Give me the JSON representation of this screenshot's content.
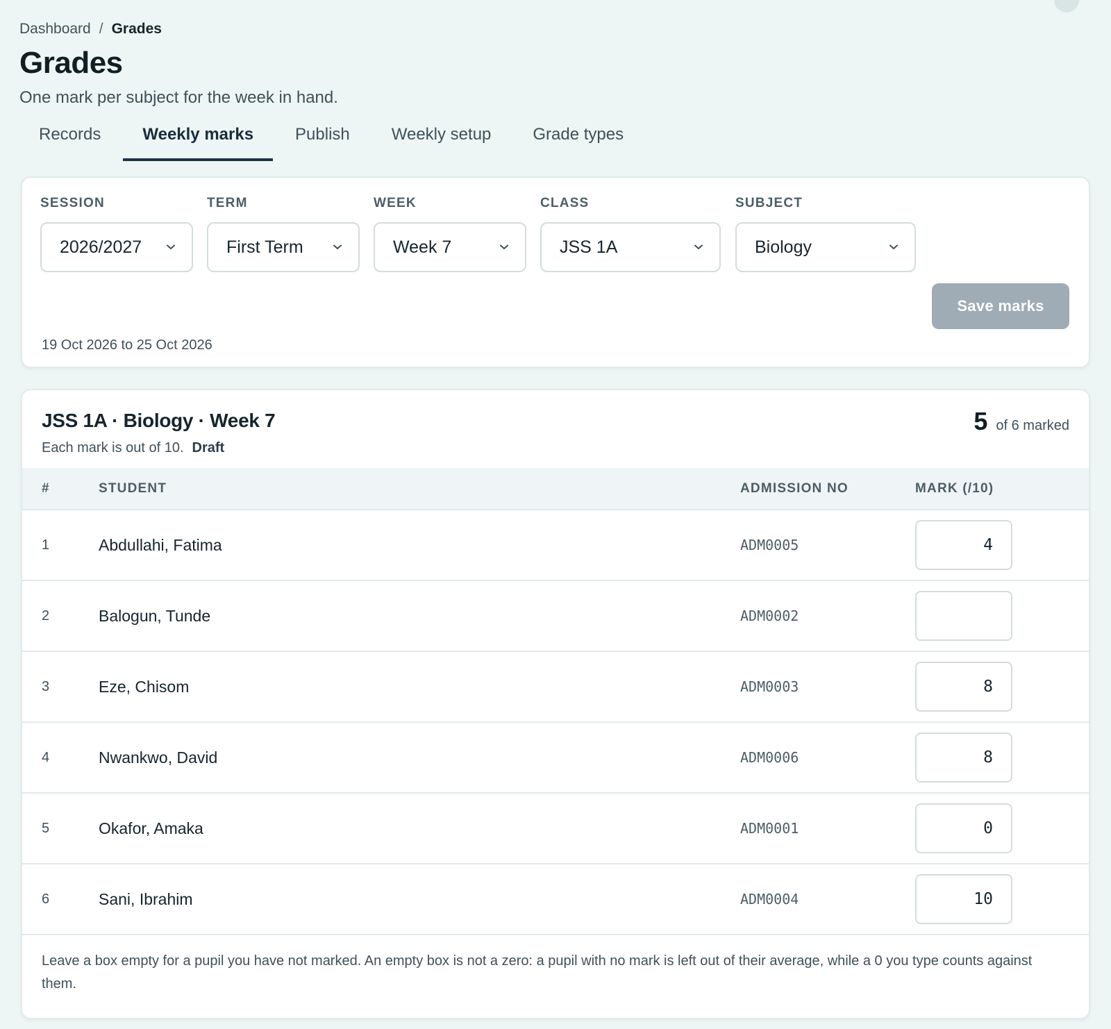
{
  "breadcrumb": {
    "parent": "Dashboard",
    "separator": "/",
    "current": "Grades"
  },
  "page": {
    "title": "Grades",
    "subtitle": "One mark per subject for the week in hand."
  },
  "tabs": [
    {
      "label": "Records",
      "active": false
    },
    {
      "label": "Weekly marks",
      "active": true
    },
    {
      "label": "Publish",
      "active": false
    },
    {
      "label": "Weekly setup",
      "active": false
    },
    {
      "label": "Grade types",
      "active": false
    }
  ],
  "filters": {
    "session": {
      "label": "SESSION",
      "value": "2026/2027"
    },
    "term": {
      "label": "TERM",
      "value": "First Term"
    },
    "week": {
      "label": "WEEK",
      "value": "Week 7"
    },
    "class": {
      "label": "CLASS",
      "value": "JSS 1A"
    },
    "subject": {
      "label": "SUBJECT",
      "value": "Biology"
    },
    "save_label": "Save marks",
    "date_range": "19 Oct 2026 to 25 Oct 2026"
  },
  "marks_table": {
    "heading": "JSS 1A · Biology · Week 7",
    "out_of_note": "Each mark is out of 10.",
    "status": "Draft",
    "marked_count": "5",
    "marked_total_text": "of 6 marked",
    "columns": {
      "num": "#",
      "student": "STUDENT",
      "admission": "ADMISSION NO",
      "mark": "MARK (/10)"
    },
    "rows": [
      {
        "num": "1",
        "student": "Abdullahi, Fatima",
        "admission": "ADM0005",
        "mark": "4"
      },
      {
        "num": "2",
        "student": "Balogun, Tunde",
        "admission": "ADM0002",
        "mark": ""
      },
      {
        "num": "3",
        "student": "Eze, Chisom",
        "admission": "ADM0003",
        "mark": "8"
      },
      {
        "num": "4",
        "student": "Nwankwo, David",
        "admission": "ADM0006",
        "mark": "8"
      },
      {
        "num": "5",
        "student": "Okafor, Amaka",
        "admission": "ADM0001",
        "mark": "0"
      },
      {
        "num": "6",
        "student": "Sani, Ibrahim",
        "admission": "ADM0004",
        "mark": "10"
      }
    ],
    "footnote": "Leave a box empty for a pupil you have not marked. An empty box is not a zero: a pupil with no mark is left out of their average, while a 0 you type counts against them."
  },
  "colors": {
    "background": "#eef6f5",
    "tab_active_underline": "#1c3349",
    "save_button_disabled": "#9fabb5"
  }
}
